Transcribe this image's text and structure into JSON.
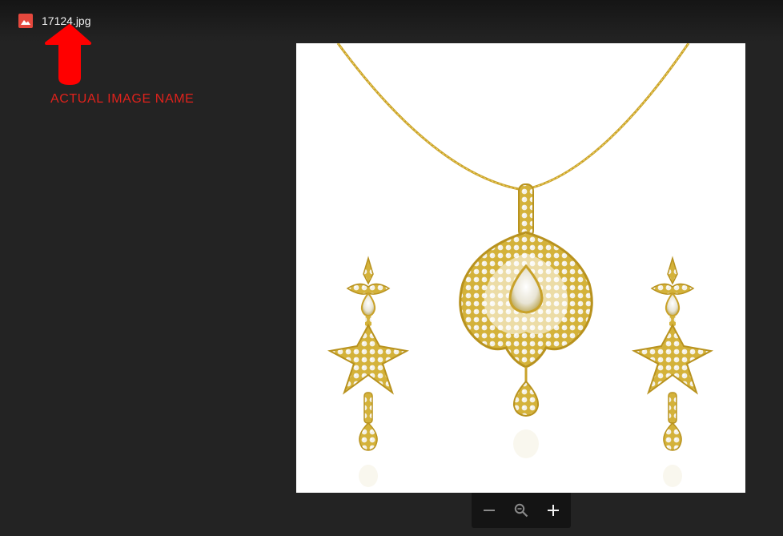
{
  "header": {
    "file_name": "17124.jpg",
    "file_icon": "image-icon",
    "file_icon_color": "#e5483d"
  },
  "annotation": {
    "text": "ACTUAL IMAGE NAME",
    "color": "#e0221c",
    "arrow_icon": "arrow-up-icon"
  },
  "viewer": {
    "image_subject": "gold necklace pendant with matching earrings"
  },
  "zoom_controls": {
    "zoom_out_icon": "minus-icon",
    "zoom_reset_icon": "magnifier-icon",
    "zoom_in_icon": "plus-icon"
  }
}
